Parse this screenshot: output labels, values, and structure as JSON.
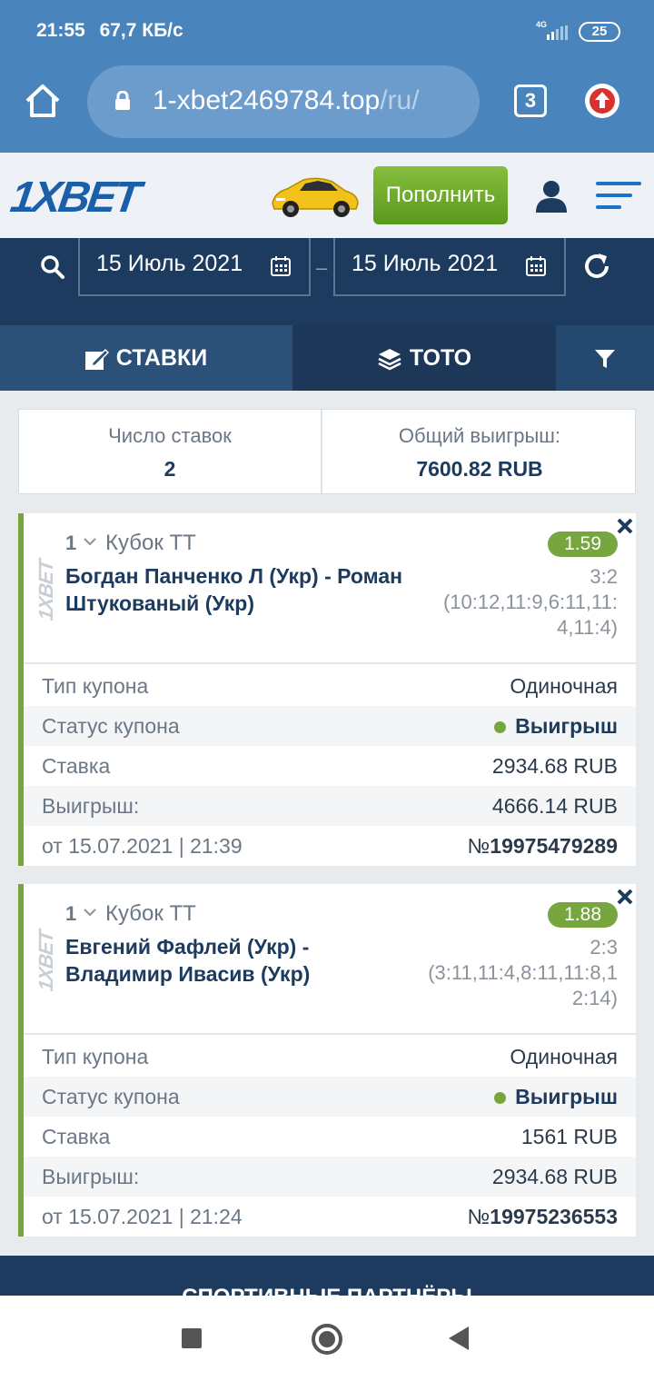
{
  "status_bar": {
    "time": "21:55",
    "speed": "67,7 КБ/с",
    "network": "4G",
    "battery": "25"
  },
  "browser": {
    "url_host": "1-xbet2469784.top",
    "url_path": "/ru/",
    "tab_count": "3"
  },
  "header": {
    "logo_prefix": "1X",
    "logo_suffix": "BET",
    "deposit_label": "Пополнить"
  },
  "filter": {
    "date_from": "15 Июль 2021",
    "date_to": "15 Июль 2021",
    "separator": "–"
  },
  "tabs": {
    "bets": "СТАВКИ",
    "toto": "ТОТО"
  },
  "summary": {
    "count_label": "Число ставок",
    "count_value": "2",
    "total_label": "Общий выигрыш:",
    "total_value": "7600.82 RUB"
  },
  "bets": [
    {
      "num": "1",
      "league": "Кубок ТТ",
      "teams": "Богдан Панченко Л (Укр) - Роман Штукованый (Укр)",
      "odds": "1.59",
      "score": "3:2",
      "score_detail": "(10:12,11:9,6:11,11:4,11:4)",
      "coupon_type_label": "Тип купона",
      "coupon_type": "Одиночная",
      "status_label": "Статус купона",
      "status": "Выигрыш",
      "stake_label": "Ставка",
      "stake": "2934.68 RUB",
      "win_label": "Выигрыш:",
      "win": "4666.14 RUB",
      "date": "от 15.07.2021 | 21:39",
      "no_prefix": "№",
      "no": "19975479289"
    },
    {
      "num": "1",
      "league": "Кубок ТТ",
      "teams": "Евгений Фафлей (Укр) - Владимир Ивасив (Укр)",
      "odds": "1.88",
      "score": "2:3",
      "score_detail": "(3:11,11:4,8:11,11:8,12:14)",
      "coupon_type_label": "Тип купона",
      "coupon_type": "Одиночная",
      "status_label": "Статус купона",
      "status": "Выигрыш",
      "stake_label": "Ставка",
      "stake": "1561 RUB",
      "win_label": "Выигрыш:",
      "win": "2934.68 RUB",
      "date": "от 15.07.2021 | 21:24",
      "no_prefix": "№",
      "no": "19975236553"
    }
  ],
  "footer": {
    "title": "СПОРТИВНЫЕ ПАРТНЁРЫ"
  },
  "colors": {
    "brand": "#1c3b5e",
    "accent_green": "#76a63d",
    "chrome_blue": "#4a84bd"
  }
}
